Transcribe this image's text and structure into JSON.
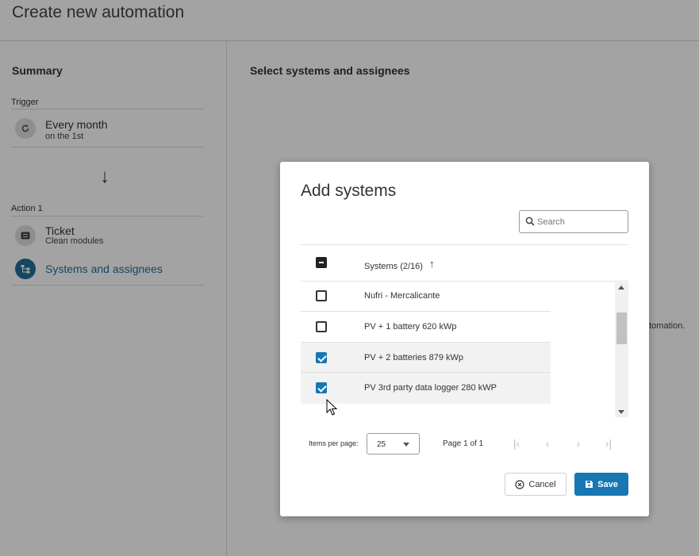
{
  "page": {
    "title": "Create new automation",
    "summary_title": "Summary",
    "trigger_label": "Trigger",
    "trigger": {
      "main": "Every month",
      "sub": "on the 1st",
      "icon": "refresh-icon"
    },
    "action_label": "Action 1",
    "action": {
      "main": "Ticket",
      "sub": "Clean modules",
      "icon": "ticket-icon"
    },
    "systems_item": {
      "label": "Systems and assignees",
      "icon": "hierarchy-icon"
    },
    "main_title": "Select systems and assignees",
    "background_hint": "utomation."
  },
  "modal": {
    "title": "Add systems",
    "search": {
      "placeholder": "Search",
      "value": ""
    },
    "column_header": "Systems (2/16)",
    "rows": [
      {
        "label": "...",
        "checked": false
      },
      {
        "label": "Nufri - Mercalicante",
        "checked": false
      },
      {
        "label": "PV + 1 battery 620 kWp",
        "checked": false
      },
      {
        "label": "PV + 2 batteries 879 kWp",
        "checked": true
      },
      {
        "label": "PV 3rd party data logger 280 kWP",
        "checked": true
      }
    ],
    "pager": {
      "items_per_page_label": "Items per page:",
      "items_per_page_value": "25",
      "page_info": "Page 1 of 1"
    },
    "cancel_label": "Cancel",
    "save_label": "Save"
  },
  "colors": {
    "accent": "#1677b3",
    "nav_active": "#1f6f9a"
  }
}
